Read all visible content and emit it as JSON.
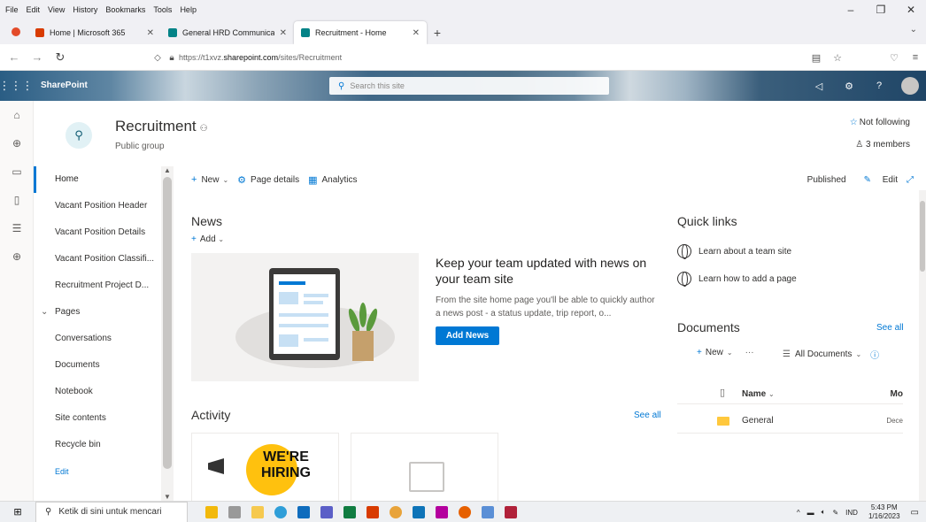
{
  "browser": {
    "menu": [
      "File",
      "Edit",
      "View",
      "History",
      "Bookmarks",
      "Tools",
      "Help"
    ],
    "tabs": [
      {
        "title": "Home | Microsoft 365",
        "color": "#d83b01",
        "active": false
      },
      {
        "title": "General HRD Communication S",
        "color": "#038387",
        "active": false
      },
      {
        "title": "Recruitment - Home",
        "color": "#038387",
        "active": true
      }
    ],
    "url_prefix": "https://t1xvz.",
    "url_domain": "sharepoint.com",
    "url_path": "/sites/Recruitment"
  },
  "suite": {
    "brand": "SharePoint",
    "search_placeholder": "Search this site"
  },
  "site": {
    "title": "Recruitment",
    "subtitle": "Public group",
    "follow": "Not following",
    "members": "3 members"
  },
  "nav": {
    "items": [
      {
        "label": "Home",
        "active": true
      },
      {
        "label": "Vacant Position Header"
      },
      {
        "label": "Vacant Position Details"
      },
      {
        "label": "Vacant Position Classifi..."
      },
      {
        "label": "Recruitment Project D..."
      },
      {
        "label": "Pages",
        "expandable": true
      },
      {
        "label": "Conversations"
      },
      {
        "label": "Documents"
      },
      {
        "label": "Notebook"
      },
      {
        "label": "Site contents"
      },
      {
        "label": "Recycle bin"
      }
    ],
    "edit": "Edit"
  },
  "command": {
    "new": "New",
    "page_details": "Page details",
    "analytics": "Analytics",
    "published": "Published",
    "edit": "Edit"
  },
  "news": {
    "title": "News",
    "add": "Add",
    "headline": "Keep your team updated with news on your team site",
    "description": "From the site home page you'll be able to quickly author a news post - a status update, trip report, o...",
    "button": "Add News"
  },
  "activity": {
    "title": "Activity",
    "see_all": "See all",
    "hiring_line1": "WE'RE",
    "hiring_line2": "HIRING"
  },
  "quick_links": {
    "title": "Quick links",
    "items": [
      "Learn about a team site",
      "Learn how to add a page"
    ]
  },
  "documents": {
    "title": "Documents",
    "see_all": "See all",
    "new": "New",
    "more": "···",
    "view": "All Documents",
    "col_name": "Name",
    "col_modified": "Mo",
    "rows": [
      {
        "name": "General",
        "modified": "Dece"
      }
    ]
  },
  "taskbar": {
    "search_placeholder": "Ketik di sini untuk mencari",
    "lang": "IND",
    "time": "5:43 PM",
    "date": "1/16/2023"
  }
}
